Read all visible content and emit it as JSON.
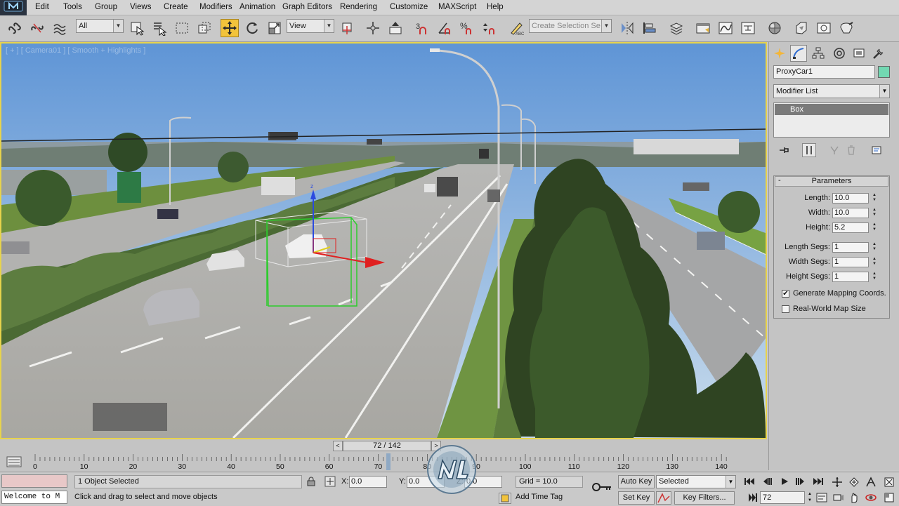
{
  "app": {
    "logo": "⟂"
  },
  "menu": [
    "Edit",
    "Tools",
    "Group",
    "Views",
    "Create",
    "Modifiers",
    "Animation",
    "Graph Editors",
    "Rendering",
    "Customize",
    "MAXScript",
    "Help"
  ],
  "toolbar": {
    "filter_value": "All",
    "ref_coord_value": "View",
    "selection_set_placeholder": "Create Selection Se",
    "active_tool": "select-and-move"
  },
  "viewport": {
    "label": "[ + ] [ Camera01 ] [ Smooth + Highlights ]",
    "border_color": "#e7d34c"
  },
  "command_panel": {
    "object_name": "ProxyCar1",
    "object_color": "#72d8b2",
    "modifier_list": "Modifier List",
    "stack_item": "Box",
    "rollout_title": "Parameters",
    "rollout_toggle": "-",
    "params": [
      {
        "label": "Length:",
        "value": "10.0"
      },
      {
        "label": "Width:",
        "value": "10.0"
      },
      {
        "label": "Height:",
        "value": "5.2"
      },
      {
        "label": "Length Segs:",
        "value": "1"
      },
      {
        "label": "Width Segs:",
        "value": "1"
      },
      {
        "label": "Height Segs:",
        "value": "1"
      }
    ],
    "checkboxes": [
      {
        "label": "Generate Mapping Coords.",
        "checked": true
      },
      {
        "label": "Real-World Map Size",
        "checked": false
      }
    ]
  },
  "timeline": {
    "slider_label": "72 / 142",
    "current_frame": 72,
    "total_frames": 142,
    "ticks": [
      "0",
      "10",
      "20",
      "30",
      "40",
      "50",
      "60",
      "70",
      "80",
      "90",
      "100",
      "110",
      "120",
      "130",
      "140"
    ]
  },
  "status": {
    "maxscript_listener": "Welcome to M",
    "selection": "1 Object Selected",
    "prompt": "Click and drag to select and move objects",
    "x_label": "X:",
    "x_value": "0.0",
    "y_label": "Y:",
    "y_value": "0.0",
    "z_label": "Z:",
    "z_value": "0.0",
    "grid": "Grid = 10.0",
    "add_time_tag": "Add Time Tag",
    "auto_key": "Auto Key",
    "set_key": "Set Key",
    "selected_mode": "Selected",
    "key_filters": "Key Filters...",
    "frame": "72"
  }
}
